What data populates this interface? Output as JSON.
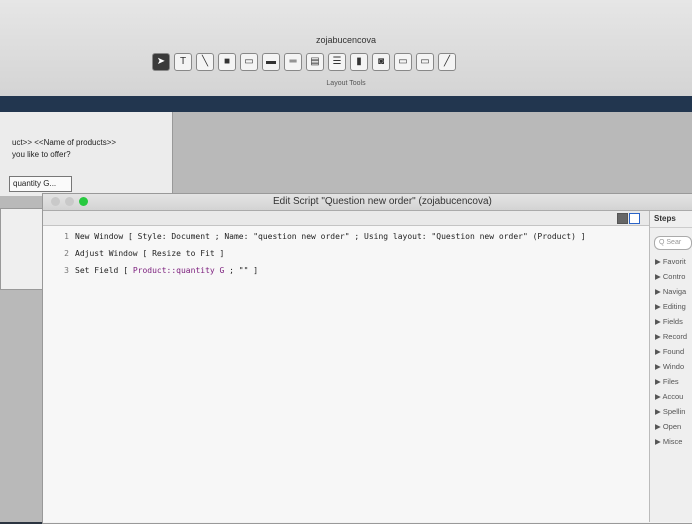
{
  "back_window": {
    "title": "zojabucencova",
    "toolbar_label": "Layout Tools",
    "tools": [
      "arrow-tool-icon",
      "text-tool-icon",
      "line-tool-icon",
      "rectangle-tool-icon",
      "field-tool-icon",
      "button-tool-icon",
      "button-bar-tool-icon",
      "tab-control-tool-icon",
      "portal-tool-icon",
      "chart-tool-icon",
      "web-viewer-tool-icon",
      "popover-tool-icon",
      "popover-button-tool-icon",
      "format-painter-icon"
    ],
    "layout_line1": "uct>> <<Name of products>>",
    "layout_line2": "you like to offer?",
    "quantity_field": "quantity G..."
  },
  "script_window": {
    "title": "Edit Script \"Question new order\" (zojabucencova)",
    "lines": [
      {
        "num": "1",
        "step": "New Window",
        "params": "[ Style: Document ; Name: \"question new order\" ; Using layout: \"Question new order\" (Product) ]"
      },
      {
        "num": "2",
        "step": "Adjust Window",
        "params": "[ Resize to Fit ]"
      },
      {
        "num": "3",
        "step": "Set Field",
        "open": "[ ",
        "field": "Product::quantity G",
        "rest": " ; \"\" ]"
      }
    ]
  },
  "steps_panel": {
    "header": "Steps",
    "search_placeholder": "Q Sear",
    "categories": [
      "▶ Favorit",
      "▶ Contro",
      "▶ Naviga",
      "▶ Editing",
      "▶ Fields",
      "▶ Record",
      "▶ Found",
      "▶ Windo",
      "▶ Files",
      "▶ Accou",
      "▶ Spellin",
      "▶ Open",
      "▶ Misce"
    ]
  },
  "colors": {
    "field_ref": "#7b1c7c",
    "green_button": "#27c93f",
    "dark_strip": "#22364f"
  }
}
